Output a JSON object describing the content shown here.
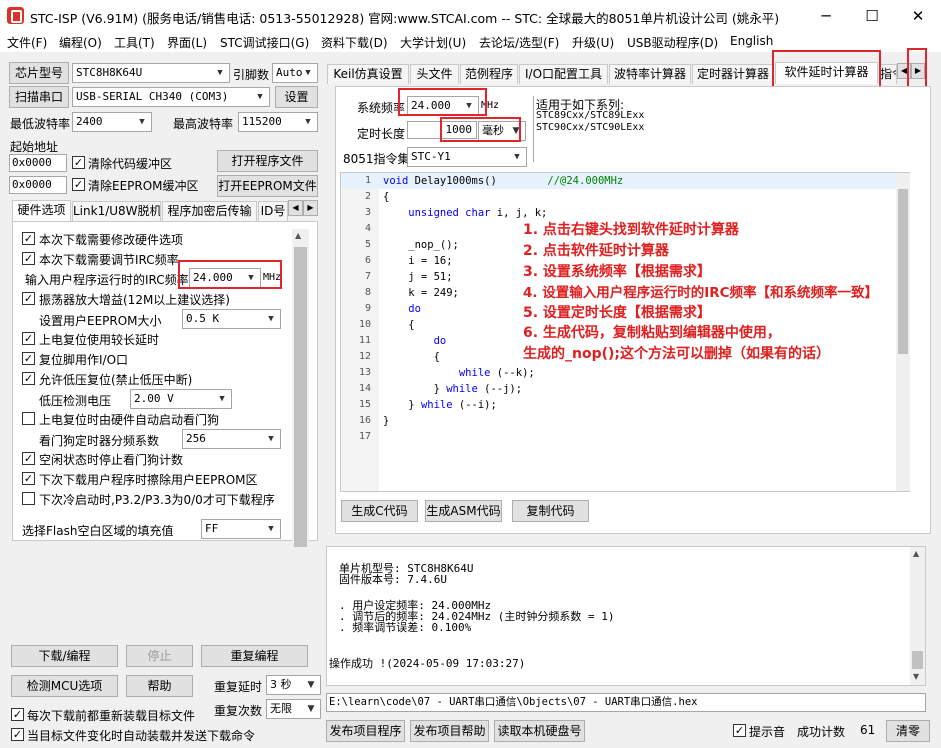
{
  "title_bar": {
    "title": "STC-ISP (V6.91M) (服务电话/销售电话: 0513-55012928) 官网:www.STCAI.com  -- STC: 全球最大的8051单片机设计公司 (姚永平)",
    "minimize": "─",
    "maximize": "☐",
    "close": "✕"
  },
  "menu": [
    "文件(F)",
    "编程(O)",
    "工具(T)",
    "界面(L)",
    "STC调试接口(G)",
    "资料下载(D)",
    "大学计划(U)",
    "去论坛/选型(F)",
    "升级(U)",
    "USB驱动程序(D)",
    "English"
  ],
  "left": {
    "chip_label": "芯片型号",
    "chip_value": "STC8H8K64U",
    "pins_label": "引脚数",
    "pins_value": "Auto",
    "scan_btn": "扫描串口",
    "port_value": "USB-SERIAL CH340 (COM3)",
    "settings_btn": "设置",
    "min_baud_label": "最低波特率",
    "min_baud_value": "2400",
    "max_baud_label": "最高波特率",
    "max_baud_value": "115200",
    "start_addr_label": "起始地址",
    "addr1": "0x0000",
    "clear_code_label": "清除代码缓冲区",
    "open_prog_btn": "打开程序文件",
    "addr2": "0x0000",
    "clear_eeprom_label": "清除EEPROM缓冲区",
    "open_eeprom_btn": "打开EEPROM文件",
    "tabs": [
      "硬件选项",
      "Link1/U8W脱机",
      "程序加密后传输",
      "ID号"
    ],
    "opt_modify": "本次下载需要修改硬件选项",
    "opt_adjust_irc": "本次下载需要调节IRC频率",
    "irc_label": "输入用户程序运行时的IRC频率",
    "irc_value": "24.000",
    "irc_unit": "MHz",
    "opt_osc": "振荡器放大增益(12M以上建议选择)",
    "eeprom_size_label": "设置用户EEPROM大小",
    "eeprom_size_value": "0.5 K",
    "opt_por": "上电复位使用较长延时",
    "opt_reset_io": "复位脚用作I/O口",
    "opt_lvr": "允许低压复位(禁止低压中断)",
    "lvd_label": "低压检测电压",
    "lvd_value": "2.00 V",
    "opt_wdt": "上电复位时由硬件自动启动看门狗",
    "wdt_div_label": "看门狗定时器分频系数",
    "wdt_div_value": "256",
    "opt_idle": "空闲状态时停止看门狗计数",
    "opt_erase_eeprom": "下次下载用户程序时擦除用户EEPROM区",
    "opt_p32": "下次冷启动时,P3.2/P3.3为0/0才可下载程序",
    "fill_label": "选择Flash空白区域的填充值",
    "fill_value": "FF",
    "download_btn": "下载/编程",
    "stop_btn": "停止",
    "reprog_btn": "重复编程",
    "detect_btn": "检测MCU选项",
    "help_btn": "帮助",
    "repeat_delay_label": "重复延时",
    "repeat_delay_value": "3 秒",
    "reload_label": "每次下载前都重新装载目标文件",
    "repeat_count_label": "重复次数",
    "repeat_count_value": "无限",
    "auto_load_label": "当目标文件变化时自动装载并发送下载命令"
  },
  "right": {
    "tabs": [
      "Keil仿真设置",
      "头文件",
      "范例程序",
      "I/O口配置工具",
      "波特率计算器",
      "定时器计算器",
      "软件延时计算器",
      "指令"
    ],
    "sys_freq_label": "系统频率",
    "sys_freq_value": "24.000",
    "sys_freq_unit": "MHz",
    "delay_label": "定时长度",
    "delay_value": "1000",
    "delay_unit": "毫秒",
    "inst_set_label": "8051指令集",
    "inst_set_value": "STC-Y1",
    "applies_title": "适用于如下系列:",
    "applies_1": "STC89Cxx/STC89LExx",
    "applies_2": "STC90Cxx/STC90LExx",
    "code_lines": [
      "1",
      "2",
      "3",
      "4",
      "5",
      "6",
      "7",
      "8",
      "9",
      "10",
      "11",
      "12",
      "13",
      "14",
      "15",
      "16",
      "17"
    ],
    "gen_c_btn": "生成C代码",
    "gen_asm_btn": "生成ASM代码",
    "copy_btn": "复制代码",
    "log_chip": "单片机型号: STC8H8K64U",
    "log_fw": "固件版本号: 7.4.6U",
    "log_user_freq": ". 用户设定频率: 24.000MHz",
    "log_adj_freq": ". 调节后的频率: 24.024MHz (主时钟分频系数 = 1)",
    "log_err": ". 频率调节误差: 0.100%",
    "log_ok": "操作成功 !(2024-05-09 17:03:27)",
    "path": "E:\\learn\\code\\07 - UART串口通信\\Objects\\07 - UART串口通信.hex",
    "publish_btn": "发布项目程序",
    "publish_help_btn": "发布项目帮助",
    "read_disk_btn": "读取本机硬盘号",
    "tip_sound": "提示音",
    "success_count_label": "成功计数",
    "success_count": "61",
    "clear_btn": "清零"
  },
  "code": {
    "l1a": "void",
    "l1b": " Delay1000ms()",
    "l1c": "        //@24.000MHz",
    "l2": "{",
    "l3a": "    unsigned char",
    "l3b": " i, j, k;",
    "l5": "    _nop_();",
    "l6": "    i = 16;",
    "l7": "    j = 51;",
    "l8": "    k = 249;",
    "l9": "    do",
    "l10": "    {",
    "l11": "        do",
    "l12": "        {",
    "l13a": "            while",
    "l13b": " (--k);",
    "l14a": "        } ",
    "l14b": "while",
    "l14c": " (--j);",
    "l15a": "    } ",
    "l15b": "while",
    "l15c": " (--i);",
    "l16": "}"
  },
  "instructions": [
    "1. 点击右键头找到软件延时计算器",
    "2. 点击软件延时计算器",
    "3. 设置系统频率【根据需求】",
    "4. 设置输入用户程序运行时的IRC频率【和系统频率一致】",
    "5. 设置定时长度【根据需求】",
    "6. 生成代码，复制粘贴到编辑器中使用，",
    "生成的_nop();这个方法可以删掉（如果有的话）"
  ]
}
